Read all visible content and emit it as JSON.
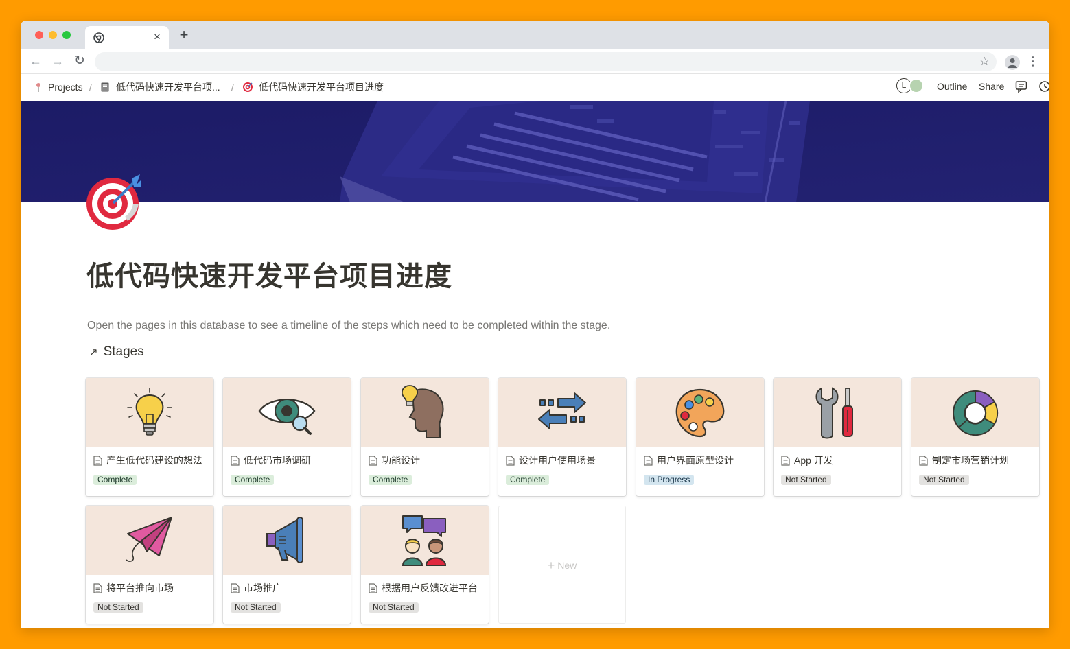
{
  "browser": {
    "tab_close": "×",
    "new_tab": "+",
    "nav_back": "←",
    "nav_forward": "→",
    "nav_reload": "↻",
    "star": "☆",
    "menu": "⋮"
  },
  "topbar": {
    "breadcrumb": [
      {
        "icon": "pin-icon",
        "label": "Projects"
      },
      {
        "icon": "notebook-icon",
        "label": "低代码快速开发平台项..."
      },
      {
        "icon": "target-icon",
        "label": "低代码快速开发平台项目进度"
      }
    ],
    "separator": "/",
    "avatar_letter": "L",
    "outline_label": "Outline",
    "share_label": "Share"
  },
  "page": {
    "title": "低代码快速开发平台项目进度",
    "description": "Open the pages in this database to see a timeline of the steps which need to be completed within the stage.",
    "database_title": "Stages",
    "database_arrow": "↗",
    "new_label": "New",
    "new_plus": "+"
  },
  "cards": [
    {
      "title": "产生低代码建设的想法",
      "status": "Complete",
      "image": "lightbulb-icon"
    },
    {
      "title": "低代码市场调研",
      "status": "Complete",
      "image": "eye-magnifier-icon"
    },
    {
      "title": "功能设计",
      "status": "Complete",
      "image": "head-bulb-icon"
    },
    {
      "title": "设计用户使用场景",
      "status": "Complete",
      "image": "arrows-exchange-icon"
    },
    {
      "title": "用户界面原型设计",
      "status": "In Progress",
      "image": "palette-icon"
    },
    {
      "title": "App 开发",
      "status": "Not Started",
      "image": "wrench-screwdriver-icon"
    },
    {
      "title": "制定市场营销计划",
      "status": "Not Started",
      "image": "donut-chart-icon"
    },
    {
      "title": "将平台推向市场",
      "status": "Not Started",
      "image": "paper-plane-icon"
    },
    {
      "title": "市场推广",
      "status": "Not Started",
      "image": "megaphone-icon"
    },
    {
      "title": "根据用户反馈改进平台",
      "status": "Not Started",
      "image": "feedback-people-icon"
    }
  ],
  "colors": {
    "background": "#FF9B00",
    "cover": "#1E1D6E",
    "card_image_bg": "#F4E6DC",
    "complete": "#DBEDDB",
    "in_progress": "#D3E5EF",
    "not_started": "#E3E2E0"
  }
}
